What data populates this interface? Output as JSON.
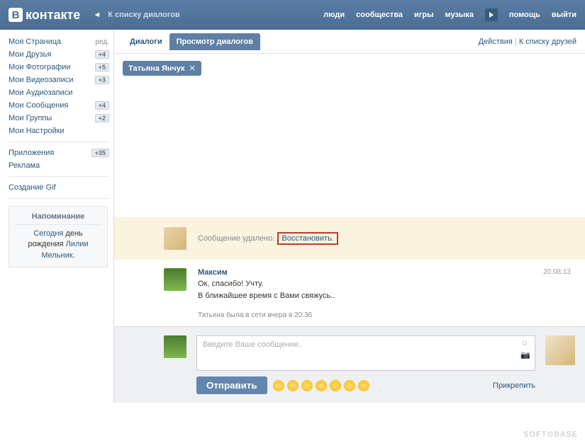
{
  "header": {
    "logo_text": "контакте",
    "logo_letter": "В",
    "back_link": "К списку диалогов",
    "nav": {
      "people": "люди",
      "communities": "сообщества",
      "games": "игры",
      "music": "музыка",
      "help": "помощь",
      "logout": "выйти"
    }
  },
  "sidebar": {
    "edit": "ред.",
    "items": [
      {
        "label": "Моя Страница",
        "badge": null
      },
      {
        "label": "Мои Друзья",
        "badge": "+4"
      },
      {
        "label": "Мои Фотографии",
        "badge": "+5"
      },
      {
        "label": "Мои Видеозаписи",
        "badge": "+3"
      },
      {
        "label": "Мои Аудиозаписи",
        "badge": null
      },
      {
        "label": "Мои Сообщения",
        "badge": "+4"
      },
      {
        "label": "Мои Группы",
        "badge": "+2"
      },
      {
        "label": "Мои Настройки",
        "badge": null
      }
    ],
    "apps": {
      "label": "Приложения",
      "badge": "+35"
    },
    "ads": "Реклама",
    "gif": "Создание Gif",
    "reminder": {
      "title": "Напоминание",
      "today": "Сегодня",
      "text1": " день рождения ",
      "name": "Лилии Мельник",
      "dot": "."
    }
  },
  "tabs": {
    "dialogs": "Диалоги",
    "view": "Просмотр диалогов",
    "actions": "Действия",
    "sep": " | ",
    "friends_list": "К списку друзей"
  },
  "conversation": {
    "name": "Татьяна Янчук"
  },
  "deleted": {
    "text": "Сообщение удалено.",
    "restore": "Восстановить."
  },
  "message": {
    "author": "Максим",
    "date": "20.08.13",
    "line1": "Ок, спасибо! Учту.",
    "line2": "В ближайшее время с Вами свяжусь.."
  },
  "status": "Татьяна была в сети вчера в 20:36",
  "compose": {
    "placeholder": "Введите Ваше сообщение..",
    "send": "Отправить",
    "attach": "Прикрепить"
  },
  "watermark": "SOFT⊙BASE"
}
